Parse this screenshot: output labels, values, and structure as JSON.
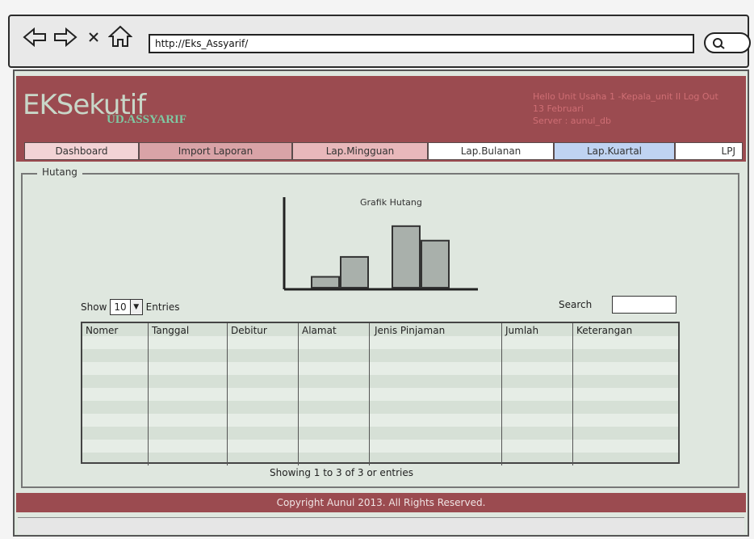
{
  "browser": {
    "url": "http://Eks_Assyarif/"
  },
  "header": {
    "logo_main": "EKSekutif",
    "logo_sub": "UD.ASSYARIF",
    "hello_line": "Hello Unit Usaha 1 -Kepala_unit II Log Out",
    "date_line": "13 Februari",
    "server_line": "Server : aunul_db"
  },
  "tabs": [
    {
      "label": "Dashboard",
      "color": "#f2d3d5"
    },
    {
      "label": "Import Laporan",
      "color": "#d9a3a7"
    },
    {
      "label": "Lap.Mingguan",
      "color": "#e8b8bb"
    },
    {
      "label": "Lap.Bulanan",
      "color": "#ffffff"
    },
    {
      "label": "Lap.Kuartal",
      "color": "#bfd3f2"
    },
    {
      "label": "LPJ",
      "color": "#ffffff"
    }
  ],
  "section": {
    "legend": "Hutang"
  },
  "chart_data": {
    "type": "bar",
    "title": "Grafik Hutang",
    "categories": [
      "",
      "",
      "",
      ""
    ],
    "values": [
      12,
      34,
      68,
      52
    ],
    "ylim": [
      0,
      100
    ],
    "xlabel": "",
    "ylabel": ""
  },
  "table_controls": {
    "show_label": "Show",
    "show_value": "10",
    "entries_label": "Entries",
    "search_label": "Search"
  },
  "table": {
    "columns": [
      "Nomer",
      "Tanggal",
      "Debitur",
      "Alamat",
      "Jenis Pinjaman",
      "Jumlah",
      "Keterangan"
    ]
  },
  "table_info": "Showing 1 to 3 of 3 or entries",
  "footer": "Copyright Aunul 2013. All Rights Reserved."
}
